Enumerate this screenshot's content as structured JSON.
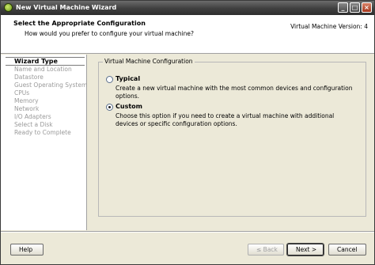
{
  "window": {
    "title": "New Virtual Machine Wizard"
  },
  "header": {
    "title": "Select the Appropriate Configuration",
    "subtitle": "How would you prefer to configure your virtual machine?",
    "version": "Virtual Machine Version: 4"
  },
  "steps": [
    {
      "label": "Wizard Type",
      "state": "active"
    },
    {
      "label": "Name and Location",
      "state": "disabled"
    },
    {
      "label": "Datastore",
      "state": "disabled"
    },
    {
      "label": "Guest Operating System",
      "state": "disabled"
    },
    {
      "label": "CPUs",
      "state": "disabled"
    },
    {
      "label": "Memory",
      "state": "disabled"
    },
    {
      "label": "Network",
      "state": "disabled"
    },
    {
      "label": "I/O Adapters",
      "state": "disabled"
    },
    {
      "label": "Select a Disk",
      "state": "disabled"
    },
    {
      "label": "Ready to Complete",
      "state": "disabled"
    }
  ],
  "config": {
    "legend": "Virtual Machine Configuration",
    "typical": {
      "label": "Typical",
      "description": "Create a new virtual machine with the most common devices and configuration options.",
      "selected": false
    },
    "custom": {
      "label": "Custom",
      "description": "Choose this option if you need to create a virtual machine with additional devices or specific configuration options.",
      "selected": true
    }
  },
  "buttons": {
    "help": "Help",
    "back": "≤ Back",
    "next": "Next >",
    "cancel": "Cancel"
  }
}
